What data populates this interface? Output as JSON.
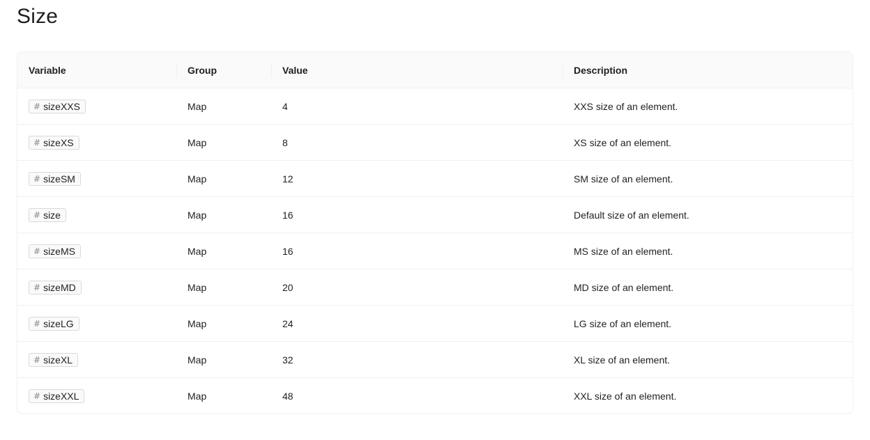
{
  "page": {
    "title": "Size"
  },
  "table": {
    "headers": {
      "variable": "Variable",
      "group": "Group",
      "value": "Value",
      "description": "Description"
    },
    "rows": [
      {
        "variable": "sizeXXS",
        "group": "Map",
        "value": "4",
        "description": "XXS size of an element."
      },
      {
        "variable": "sizeXS",
        "group": "Map",
        "value": "8",
        "description": "XS size of an element."
      },
      {
        "variable": "sizeSM",
        "group": "Map",
        "value": "12",
        "description": "SM size of an element."
      },
      {
        "variable": "size",
        "group": "Map",
        "value": "16",
        "description": "Default size of an element."
      },
      {
        "variable": "sizeMS",
        "group": "Map",
        "value": "16",
        "description": "MS size of an element."
      },
      {
        "variable": "sizeMD",
        "group": "Map",
        "value": "20",
        "description": "MD size of an element."
      },
      {
        "variable": "sizeLG",
        "group": "Map",
        "value": "24",
        "description": "LG size of an element."
      },
      {
        "variable": "sizeXL",
        "group": "Map",
        "value": "32",
        "description": "XL size of an element."
      },
      {
        "variable": "sizeXXL",
        "group": "Map",
        "value": "48",
        "description": "XXL size of an element."
      }
    ]
  },
  "icons": {
    "variable_tag": "hash-icon"
  },
  "colors": {
    "border": "#f0f0f0",
    "header_bg": "#fafafa",
    "tag_border": "#d9d9d9"
  }
}
